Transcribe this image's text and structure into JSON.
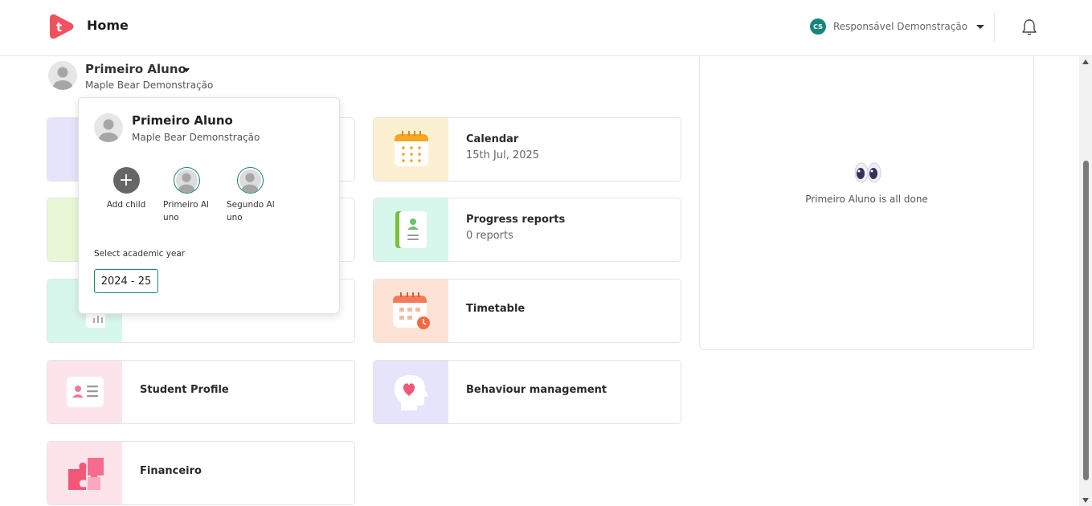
{
  "header": {
    "logo_letter": "t",
    "title": "Home",
    "user_initials": "CS",
    "user_name": "Responsável Demonstração"
  },
  "student": {
    "name": "Primeiro Aluno",
    "school": "Maple Bear Demonstração"
  },
  "cards": {
    "calendar": {
      "title": "Calendar",
      "subtitle": "15th Jul, 2025"
    },
    "progress_reports": {
      "title": "Progress reports",
      "subtitle": "0 reports"
    },
    "timetable": {
      "title": "Timetable"
    },
    "student_profile": {
      "title": "Student Profile"
    },
    "behaviour": {
      "title": "Behaviour management"
    },
    "financeiro": {
      "title": "Financeiro"
    }
  },
  "right_panel": {
    "done_text": "Primeiro Aluno is all done"
  },
  "popover": {
    "name": "Primeiro Aluno",
    "school": "Maple Bear Demonstração",
    "children": [
      {
        "label": "Add child",
        "icon": "plus-icon"
      },
      {
        "label": "Primeiro Aluno",
        "icon": "avatar-icon"
      },
      {
        "label": "Segundo Aluno",
        "icon": "avatar-icon"
      }
    ],
    "year_label": "Select academic year",
    "year_value": "2024 - 25"
  },
  "colors": {
    "brand": "#f0525f",
    "teal": "#16867e",
    "tile_calendar": "#fdefd1",
    "tile_progress": "#d7f7ec",
    "tile_timetable": "#fde3d6",
    "tile_profile": "#fde4ea",
    "tile_behaviour": "#e5e4fb",
    "tile_finance": "#fde4ea"
  }
}
